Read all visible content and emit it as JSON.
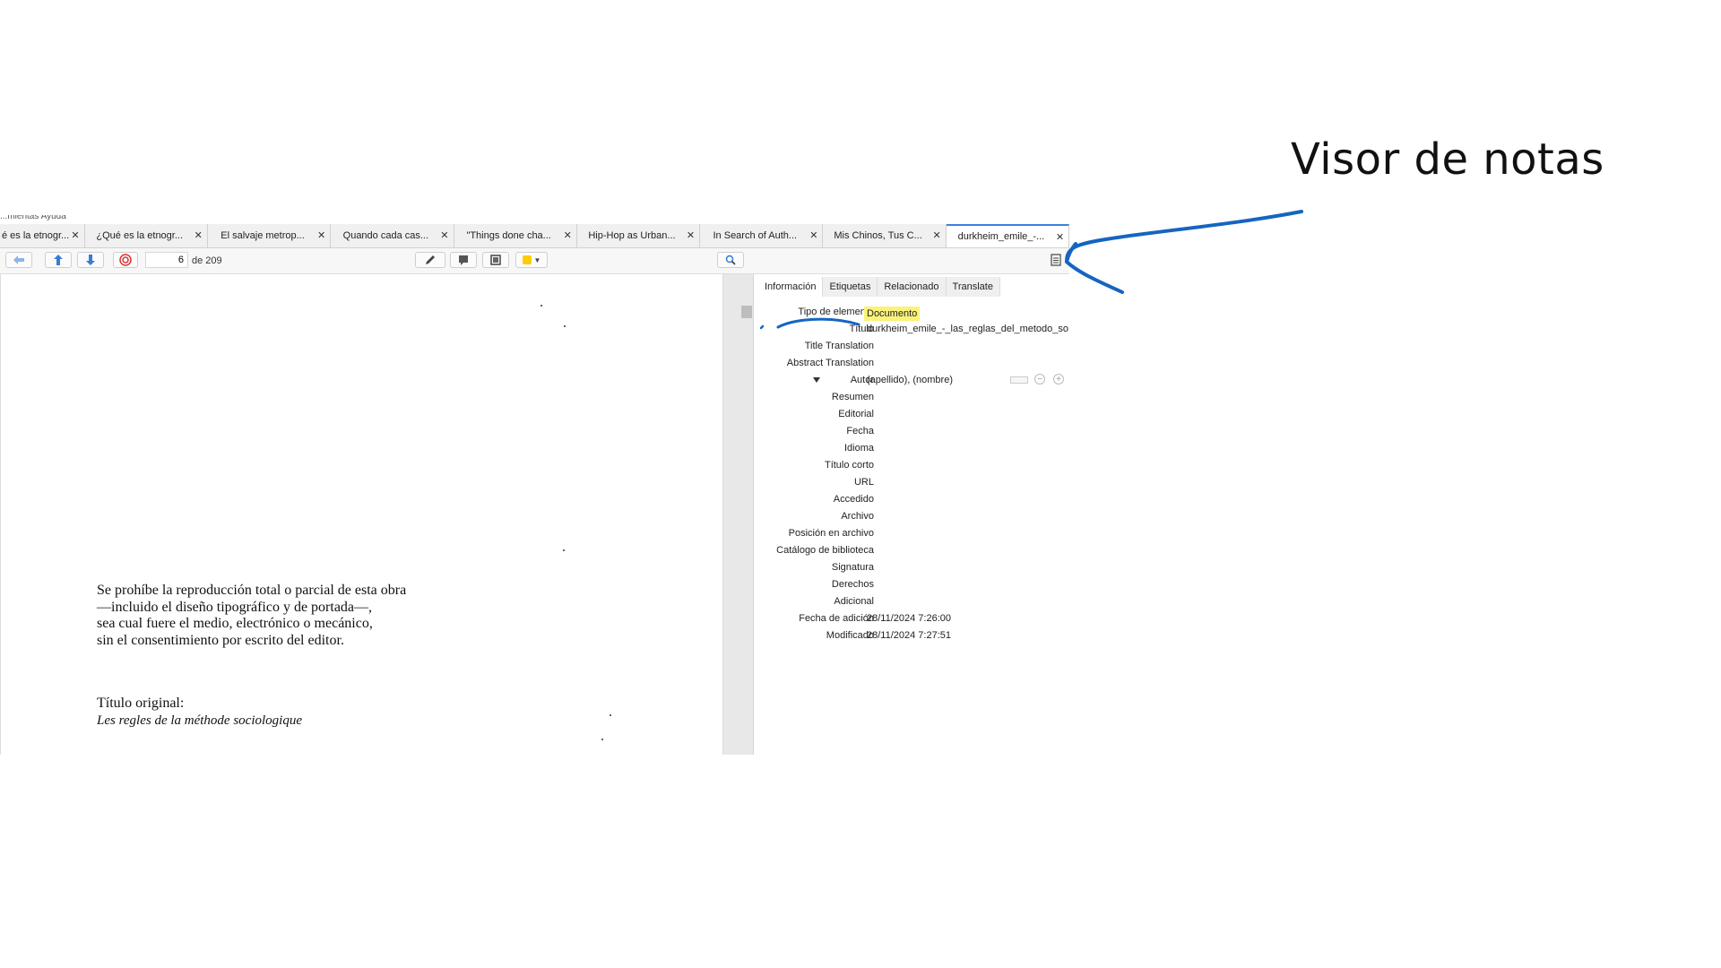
{
  "annotation": {
    "title": "Visor de notas",
    "arrow_color": "#1565c0",
    "highlight_color": "#fbf27a"
  },
  "menubar": {
    "partial_text": "...mientas   Ayuda"
  },
  "tabs": [
    {
      "label": "é es la etnogr...",
      "active": false
    },
    {
      "label": "¿Qué es la etnogr...",
      "active": false
    },
    {
      "label": "El salvaje metrop...",
      "active": false
    },
    {
      "label": "Quando cada cas...",
      "active": false
    },
    {
      "label": "\"Things done cha...",
      "active": false
    },
    {
      "label": "Hip-Hop as Urban...",
      "active": false
    },
    {
      "label": "In Search of Auth...",
      "active": false
    },
    {
      "label": "Mis Chinos, Tus C...",
      "active": false
    },
    {
      "label": "durkheim_emile_-...",
      "active": true
    }
  ],
  "toolbar": {
    "page_current": "6",
    "page_total": "de 209",
    "icons": [
      "back-arrow-icon",
      "up-arrow-icon",
      "down-arrow-icon",
      "target-icon",
      "pen-icon",
      "note-icon",
      "area-select-icon",
      "color-picker-icon",
      "search-icon",
      "notes-viewer-icon"
    ],
    "color_picker": "#ffcc00"
  },
  "document": {
    "paragraph1": [
      "Se prohíbe la reproducción total o parcial de esta obra",
      "—incluido el diseño tipográfico y de portada—,",
      "sea cual fuere el medio, electrónico o mecánico,",
      "sin el consentimiento por escrito del editor."
    ],
    "original_title_label": "Título original:",
    "original_title": "Les regles de la méthode sociologique"
  },
  "info_tabs": [
    "Información",
    "Etiquetas",
    "Relacionado",
    "Translate"
  ],
  "fields": [
    {
      "label": "Tipo de elemento",
      "value": "Documento"
    },
    {
      "label": "Título",
      "value": "durkheim_emile_-_las_reglas_del_metodo_so..."
    },
    {
      "label": "Title Translation",
      "value": ""
    },
    {
      "label": "Abstract Translation",
      "value": ""
    },
    {
      "label": "Autor",
      "value": "(apellido), (nombre)"
    },
    {
      "label": "Resumen",
      "value": ""
    },
    {
      "label": "Editorial",
      "value": ""
    },
    {
      "label": "Fecha",
      "value": ""
    },
    {
      "label": "Idioma",
      "value": ""
    },
    {
      "label": "Título corto",
      "value": ""
    },
    {
      "label": "URL",
      "value": ""
    },
    {
      "label": "Accedido",
      "value": ""
    },
    {
      "label": "Archivo",
      "value": ""
    },
    {
      "label": "Posición en archivo",
      "value": ""
    },
    {
      "label": "Catálogo de biblioteca",
      "value": ""
    },
    {
      "label": "Signatura",
      "value": ""
    },
    {
      "label": "Derechos",
      "value": ""
    },
    {
      "label": "Adicional",
      "value": ""
    },
    {
      "label": "Fecha de adición",
      "value": "28/11/2024 7:26:00"
    },
    {
      "label": "Modificado",
      "value": "28/11/2024 7:27:51"
    }
  ]
}
